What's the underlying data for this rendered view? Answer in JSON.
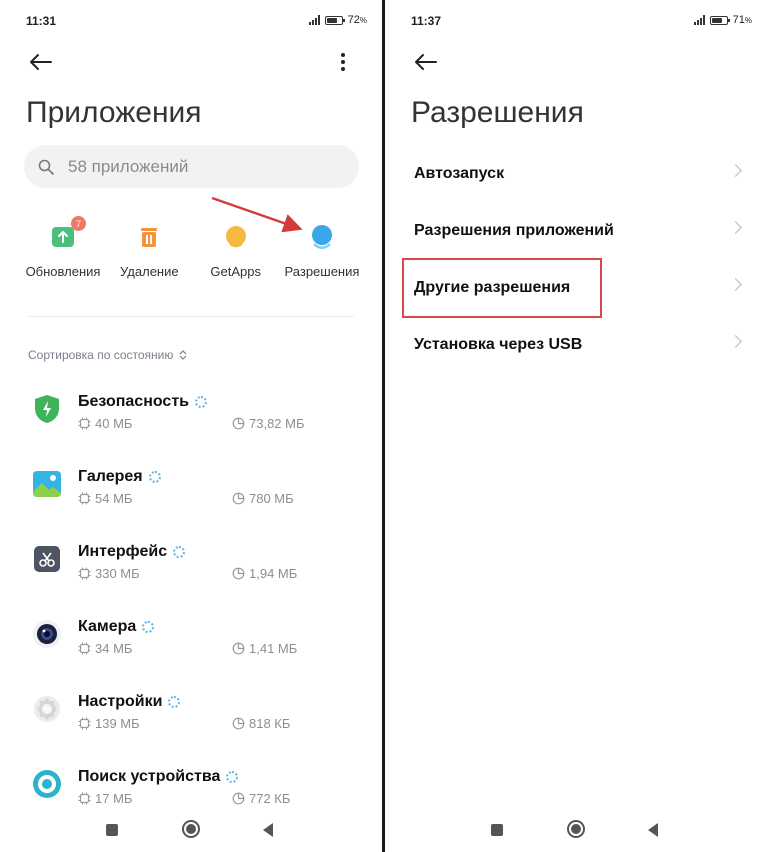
{
  "left": {
    "status": {
      "time": "11:31",
      "battery": "72",
      "battery_level": 0.72
    },
    "title": "Приложения",
    "search": {
      "placeholder": "58 приложений"
    },
    "quick_actions": [
      {
        "label": "Обновления",
        "icon": "update-icon",
        "badge": "7",
        "color": "#4cbf7a"
      },
      {
        "label": "Удаление",
        "icon": "trash-icon",
        "color": "#f3933b"
      },
      {
        "label": "GetApps",
        "icon": "getapps-icon",
        "color": "#f4b93e"
      },
      {
        "label": "Разрешения",
        "icon": "permissions-icon",
        "color": "#3aa8e8"
      }
    ],
    "sort_label": "Сортировка по состоянию",
    "apps": [
      {
        "name": "Безопасность",
        "storage": "40 МБ",
        "cache": "73,82 МБ",
        "icon": "security-shield-icon"
      },
      {
        "name": "Галерея",
        "storage": "54 МБ",
        "cache": "780 МБ",
        "icon": "gallery-icon"
      },
      {
        "name": "Интерфейс",
        "storage": "330 МБ",
        "cache": "1,94 МБ",
        "icon": "interface-icon"
      },
      {
        "name": "Камера",
        "storage": "34 МБ",
        "cache": "1,41 МБ",
        "icon": "camera-icon"
      },
      {
        "name": "Настройки",
        "storage": "139 МБ",
        "cache": "818 КБ",
        "icon": "settings-gear-icon"
      },
      {
        "name": "Поиск устройства",
        "storage": "17 МБ",
        "cache": "772 КБ",
        "icon": "find-device-icon"
      }
    ]
  },
  "right": {
    "status": {
      "time": "11:37",
      "battery": "71",
      "battery_level": 0.71
    },
    "title": "Разрешения",
    "items": [
      {
        "label": "Автозапуск"
      },
      {
        "label": "Разрешения приложений"
      },
      {
        "label": "Другие разрешения",
        "highlighted": true
      },
      {
        "label": "Установка через USB"
      }
    ]
  },
  "colors": {
    "accent": "#3aa8e8",
    "highlight_border": "#d24a4a",
    "arrow": "#d33a3a"
  }
}
